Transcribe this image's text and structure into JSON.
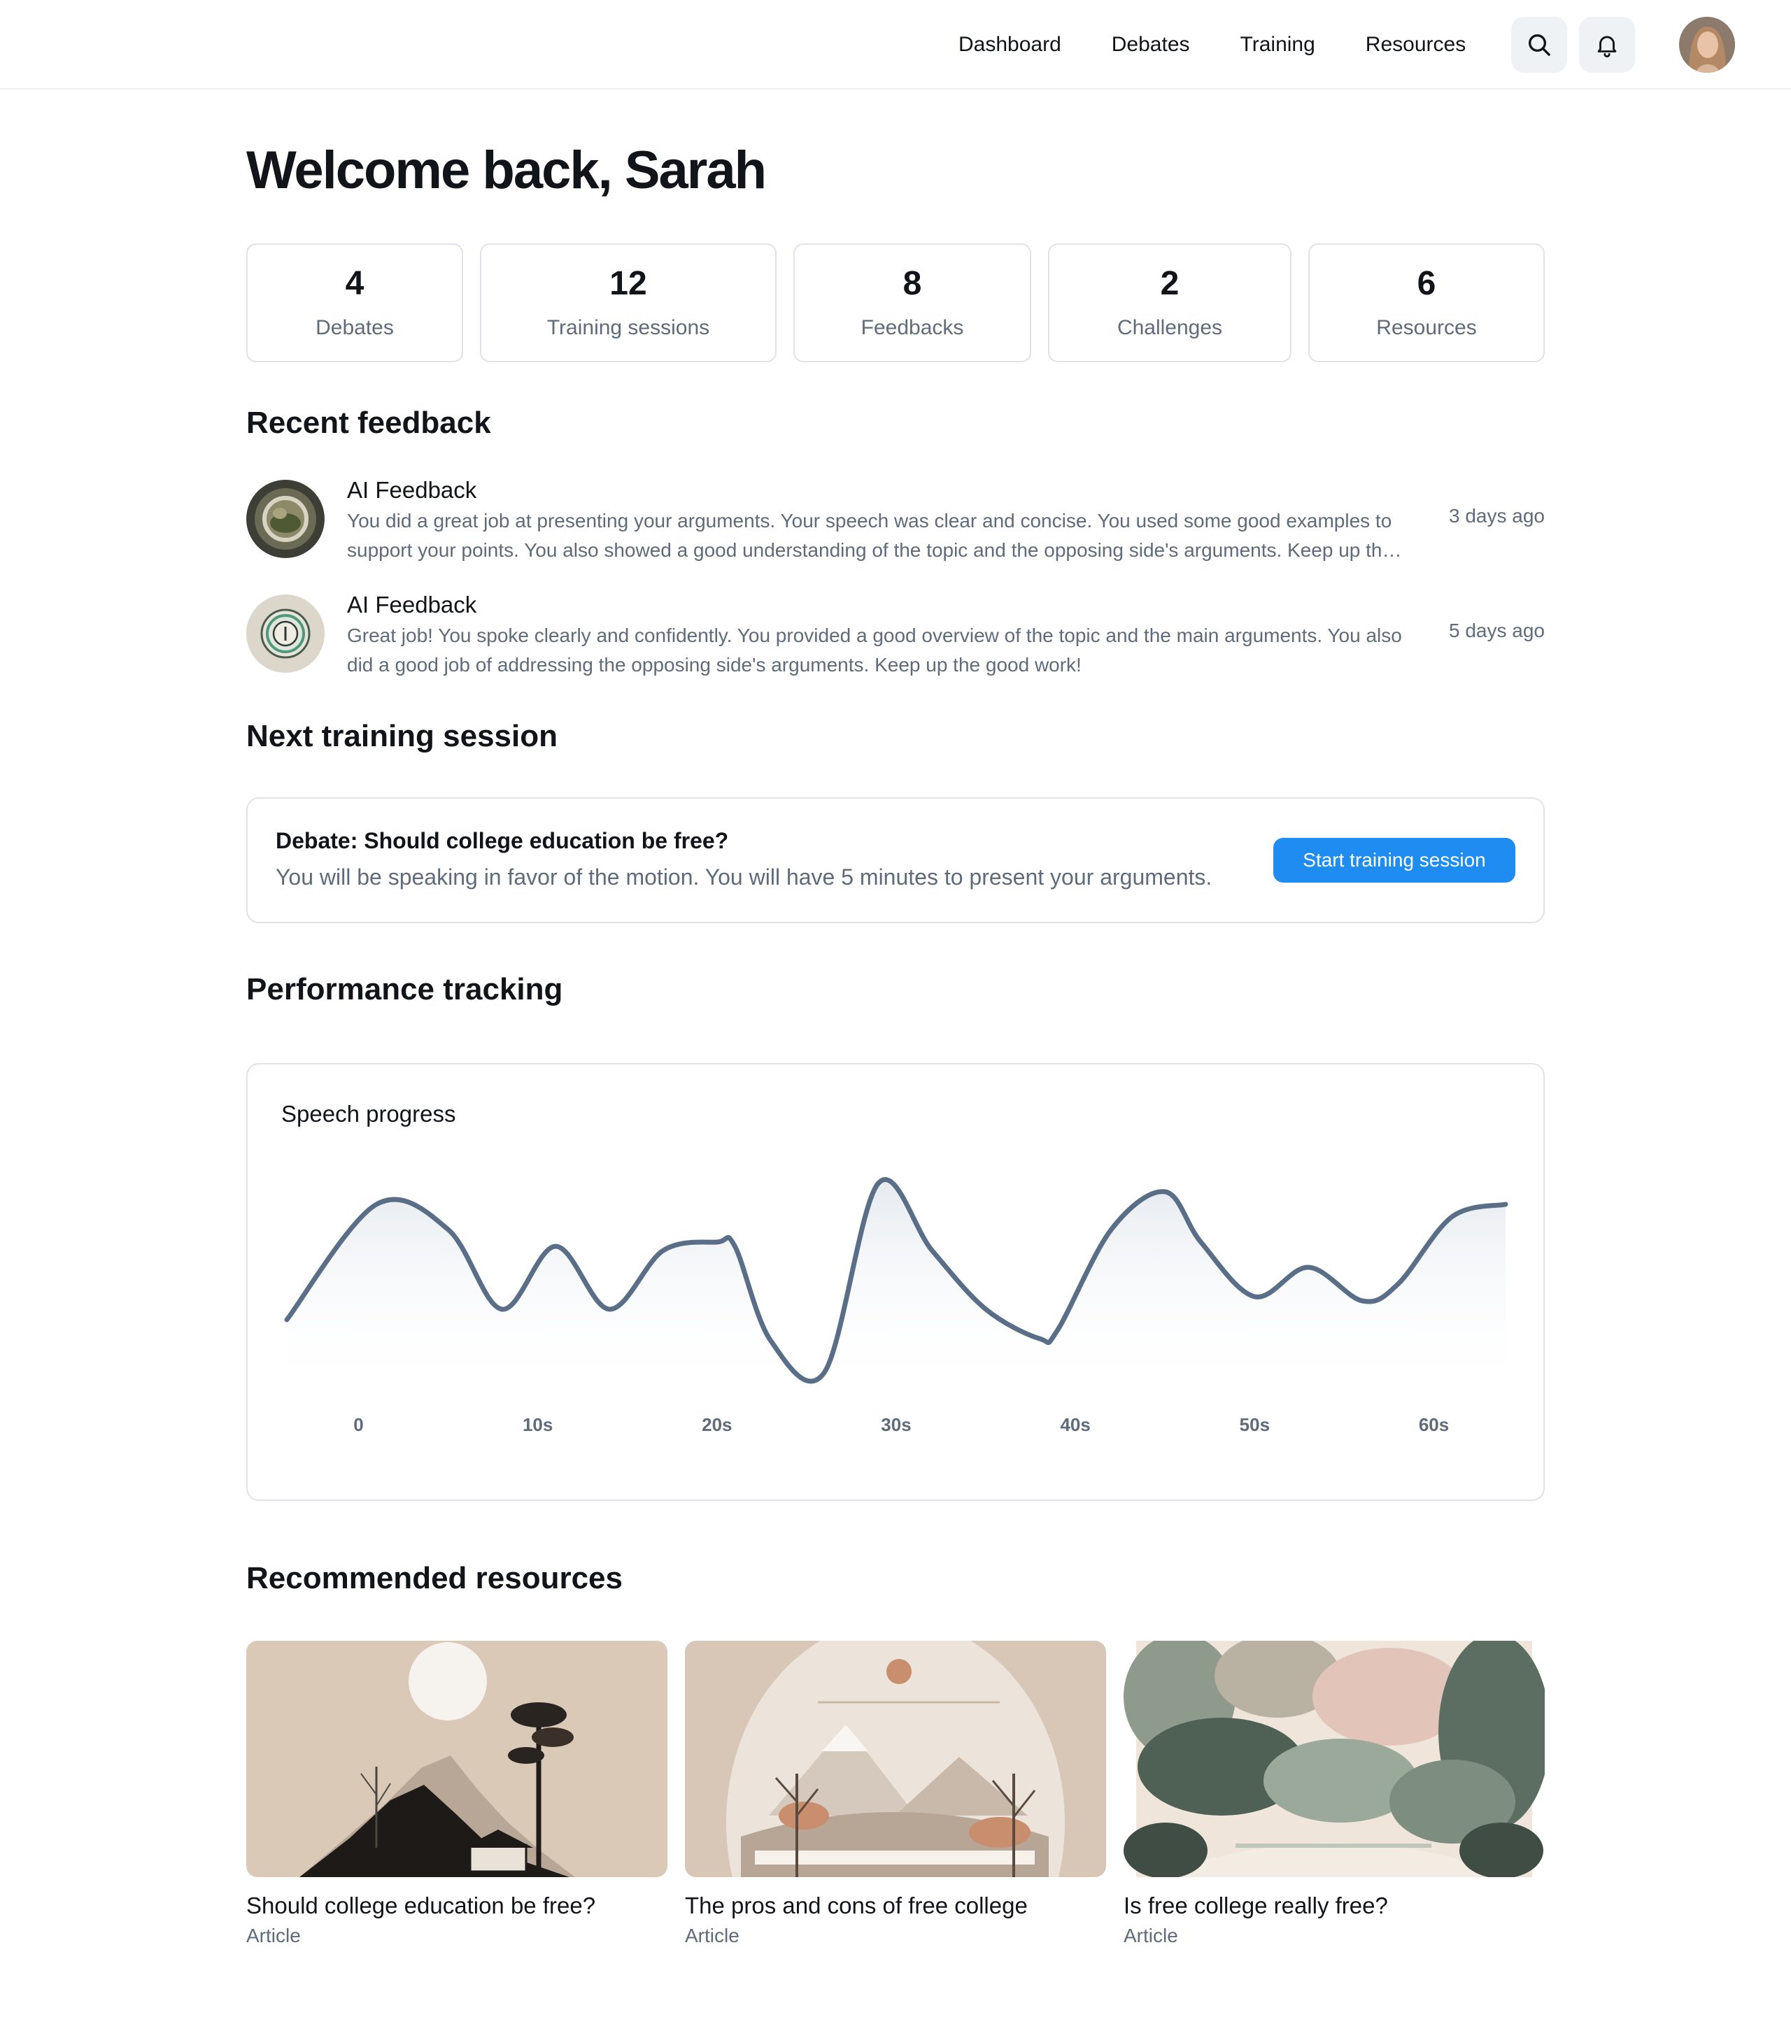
{
  "nav": {
    "items": [
      "Dashboard",
      "Debates",
      "Training",
      "Resources"
    ],
    "search_icon": "search-icon",
    "bell_icon": "bell-icon"
  },
  "welcome": {
    "title": "Welcome back, Sarah"
  },
  "stats": [
    {
      "value": "4",
      "label": "Debates"
    },
    {
      "value": "12",
      "label": "Training sessions"
    },
    {
      "value": "8",
      "label": "Feedbacks"
    },
    {
      "value": "2",
      "label": "Challenges"
    },
    {
      "value": "6",
      "label": "Resources"
    }
  ],
  "feedback": {
    "title": "Recent feedback",
    "items": [
      {
        "name": "AI Feedback",
        "line1": "You did a great job at presenting your arguments. Your speech was clear and concise. You used some good examples to",
        "line2": "support your points. You also showed a good understanding of the topic and the opposing side's arguments. Keep up th…",
        "time": "3 days ago"
      },
      {
        "name": "AI Feedback",
        "line1": "Great job! You spoke clearly and confidently. You provided a good overview of the topic and the main arguments. You also",
        "line2": "did a good job of addressing the opposing side's arguments. Keep up the good work!",
        "time": "5 days ago"
      }
    ]
  },
  "next_session": {
    "title": "Next training session",
    "card_title": "Debate: Should college education be free?",
    "card_desc": "You will be speaking in favor of the motion. You will have 5 minutes to present your arguments.",
    "button": "Start training session"
  },
  "performance": {
    "title": "Performance tracking"
  },
  "chart_data": {
    "type": "area",
    "title": "Speech progress",
    "xlabel": "",
    "ylabel": "",
    "x_ticks": [
      "0",
      "10s",
      "20s",
      "30s",
      "40s",
      "50s",
      "60s"
    ],
    "xlim": [
      -4,
      64
    ],
    "ylim": [
      0,
      1
    ],
    "grid": false,
    "series": [
      {
        "x": [
          -4,
          1,
          5,
          8,
          11,
          14,
          17,
          20,
          21,
          23,
          26,
          29,
          32,
          35,
          38,
          39,
          42,
          45,
          47,
          50,
          53,
          56,
          58,
          61,
          64
        ],
        "values": [
          0.25,
          0.8,
          0.68,
          0.3,
          0.6,
          0.3,
          0.58,
          0.62,
          0.6,
          0.15,
          0.0,
          0.9,
          0.58,
          0.3,
          0.16,
          0.2,
          0.68,
          0.86,
          0.62,
          0.36,
          0.5,
          0.34,
          0.42,
          0.74,
          0.8
        ]
      }
    ],
    "colors": {
      "line": "#5a6f87",
      "fill": "#eef1f5"
    }
  },
  "resources": {
    "title": "Recommended resources",
    "items": [
      {
        "title": "Should college education be free?",
        "type": "Article"
      },
      {
        "title": "The pros and cons of free college",
        "type": "Article"
      },
      {
        "title": "Is free college really free?",
        "type": "Article"
      }
    ]
  }
}
